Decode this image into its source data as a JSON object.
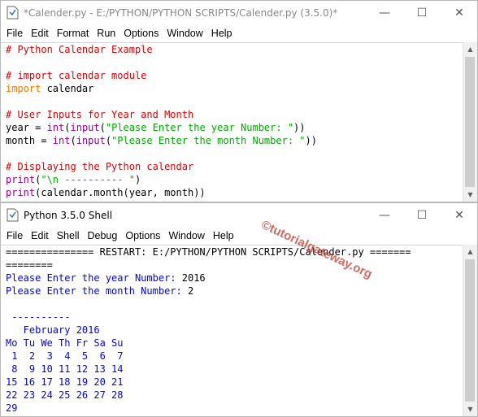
{
  "editor": {
    "title": "*Calender.py - E:/PYTHON/PYTHON SCRIPTS/Calender.py (3.5.0)*",
    "menu": [
      "File",
      "Edit",
      "Format",
      "Run",
      "Options",
      "Window",
      "Help"
    ],
    "code": {
      "l1": "# Python Calendar Example",
      "l2": "# import calendar module",
      "l3_kw": "import",
      "l3_rest": " calendar",
      "l4": "# User Inputs for Year and Month",
      "l5_a": "year = ",
      "l5_b": "int",
      "l5_c": "(",
      "l5_d": "input",
      "l5_e": "(",
      "l5_f": "\"Please Enter the year Number: \"",
      "l5_g": "))",
      "l6_a": "month = ",
      "l6_b": "int",
      "l6_c": "(",
      "l6_d": "input",
      "l6_e": "(",
      "l6_f": "\"Please Enter the month Number: \"",
      "l6_g": "))",
      "l7": "# Displaying the Python calendar",
      "l8_a": "print",
      "l8_b": "(",
      "l8_c": "\"\\n ---------- \"",
      "l8_d": ")",
      "l9_a": "print",
      "l9_b": "(calendar.month(year, month))"
    }
  },
  "shell": {
    "title": "Python 3.5.0 Shell",
    "menu": [
      "File",
      "Edit",
      "Shell",
      "Debug",
      "Options",
      "Window",
      "Help"
    ],
    "output": {
      "restart1": "=============== RESTART: E:/PYTHON/PYTHON SCRIPTS/Calender.py =======",
      "restart2": "========",
      "prompt_year": "Please Enter the year Number: ",
      "answer_year": "2016",
      "prompt_month": "Please Enter the month Number: ",
      "answer_month": "2",
      "blank": "",
      "dashes": " ----------",
      "cal_header": "   February 2016",
      "cal_days": "Mo Tu We Th Fr Sa Su",
      "week1": " 1  2  3  4  5  6  7",
      "week2": " 8  9 10 11 12 13 14",
      "week3": "15 16 17 18 19 20 21",
      "week4": "22 23 24 25 26 27 28",
      "week5": "29"
    }
  },
  "watermark": "©tutorialgateway.org",
  "colors": {
    "comment": "#dd0000",
    "keyword": "#ff7700",
    "builtin": "#900090",
    "string": "#00aa00",
    "stdout": "#0000ff"
  }
}
